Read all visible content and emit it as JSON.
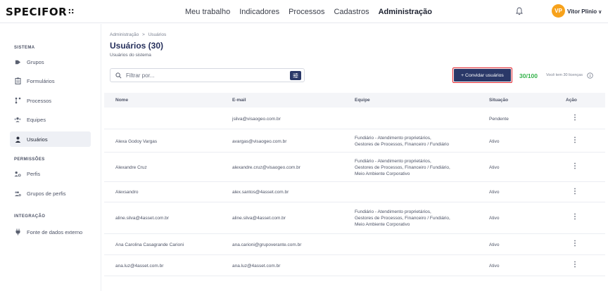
{
  "app": {
    "logo": "SPECIFOR",
    "logo_mark": "∷"
  },
  "topnav": {
    "items": [
      "Meu trabalho",
      "Indicadores",
      "Processos",
      "Cadastros",
      "Administração"
    ],
    "active": "Administração"
  },
  "user": {
    "initials": "VP",
    "name": "Vitor Plinio",
    "chevron": "∨"
  },
  "sidebar": {
    "sections": [
      {
        "title": "SISTEMA",
        "items": [
          {
            "label": "Grupos",
            "icon": "tag-icon"
          },
          {
            "label": "Formulários",
            "icon": "clipboard-icon"
          },
          {
            "label": "Processos",
            "icon": "process-icon"
          },
          {
            "label": "Equipes",
            "icon": "team-icon"
          },
          {
            "label": "Usuários",
            "icon": "user-icon",
            "active": true
          }
        ]
      },
      {
        "title": "PERMISSÕES",
        "items": [
          {
            "label": "Perfis",
            "icon": "profile-settings-icon"
          },
          {
            "label": "Grupos de perfis",
            "icon": "group-profiles-icon"
          }
        ]
      },
      {
        "title": "INTEGRAÇÃO",
        "items": [
          {
            "label": "Fonte de dados externo",
            "icon": "plug-icon"
          }
        ]
      }
    ]
  },
  "main": {
    "breadcrumb": [
      "Administração",
      "Usuários"
    ],
    "breadcrumb_sep": ">",
    "title": "Usuários (30)",
    "subtitle": "Usuários do sistema",
    "search": {
      "placeholder": "Filtrar por...",
      "value": ""
    },
    "invite_button": "+ Convidar usuários",
    "license_count": "30/100",
    "license_note": "Você tem 30 licenças"
  },
  "table": {
    "columns": [
      "Nome",
      "E-mail",
      "Equipe",
      "Situação",
      "Ação"
    ],
    "rows": [
      {
        "nome": "",
        "email": "jsilva@visaogeo.com.br",
        "equipe": [],
        "situacao": "Pendente"
      },
      {
        "nome": "Alexa Godoy Vargas",
        "email": "avargas@visaogeo.com.br",
        "equipe": [
          "Fundiário - Atendimento proprietários,",
          "Gestores de Processos, Financeiro / Fundiário"
        ],
        "situacao": "Ativo"
      },
      {
        "nome": "Alexandre Cruz",
        "email": "alexandre.cruz@visaogeo.com.br",
        "equipe": [
          "Fundiário - Atendimento proprietários,",
          "Gestores de Processos, Financeiro / Fundiário,",
          "Meio Ambiente Corporativo"
        ],
        "situacao": "Ativo"
      },
      {
        "nome": "Alexsandro",
        "email": "alex.santos@4asset.com.br",
        "equipe": [],
        "situacao": "Ativo"
      },
      {
        "nome": "aline.silva@4asset.com.br",
        "email": "aline.silva@4asset.com.br",
        "equipe": [
          "Fundiário - Atendimento proprietários,",
          "Gestores de Processos, Financeiro / Fundiário,",
          "Meio Ambiente Corporativo"
        ],
        "situacao": "Ativo"
      },
      {
        "nome": "Ana Carolina Casagrande Carioni",
        "email": "ana.carioni@grupoverante.com.br",
        "equipe": [],
        "situacao": "Ativo"
      },
      {
        "nome": "ana.luz@4asset.com.br",
        "email": "ana.luz@4asset.com.br",
        "equipe": [],
        "situacao": "Ativo"
      }
    ],
    "action_glyph": "⋮"
  }
}
